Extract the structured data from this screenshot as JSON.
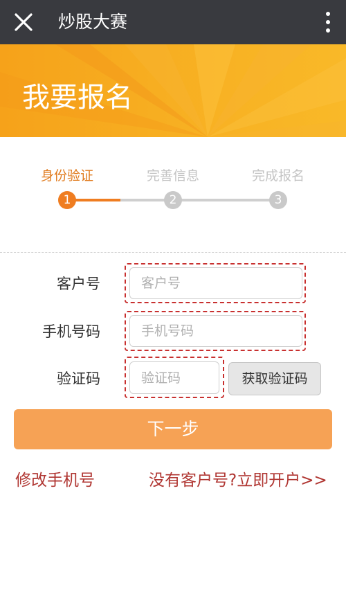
{
  "navbar": {
    "title": "炒股大赛",
    "close_icon": "close-icon",
    "more_icon": "more-vertical-icon"
  },
  "banner": {
    "title": "我要报名"
  },
  "steps": [
    {
      "label": "身份验证",
      "number": "1",
      "state": "active"
    },
    {
      "label": "完善信息",
      "number": "2",
      "state": "inactive"
    },
    {
      "label": "完成报名",
      "number": "3",
      "state": "inactive"
    }
  ],
  "form": {
    "customer_no": {
      "label": "客户号",
      "placeholder": "客户号",
      "value": ""
    },
    "phone": {
      "label": "手机号码",
      "placeholder": "手机号码",
      "value": ""
    },
    "code": {
      "label": "验证码",
      "placeholder": "验证码",
      "value": ""
    },
    "get_code_label": "获取验证码",
    "next_label": "下一步"
  },
  "links": {
    "change_phone": "修改手机号",
    "open_account": "没有客户号?立即开户>>"
  },
  "colors": {
    "navbar_bg": "#393a3f",
    "banner_orange": "#f6a21a",
    "step_active": "#ef7d21",
    "step_inactive": "#c9c9c9",
    "next_button": "#f6a255",
    "link_red": "#b03632",
    "highlight_dash": "#c8302f"
  }
}
